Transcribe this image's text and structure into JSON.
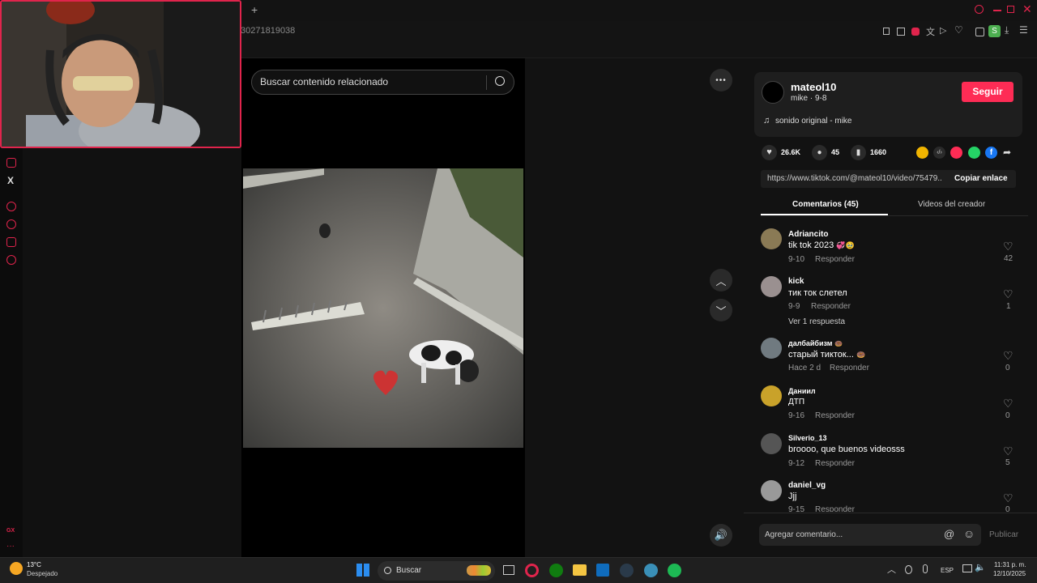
{
  "browser": {
    "url_fragment": "30271819038",
    "new_tab": "+"
  },
  "video_page": {
    "search_placeholder": "Buscar contenido relacionado",
    "more_label": "•••"
  },
  "creator": {
    "username": "mateol10",
    "subtitle": "mike · 9-8",
    "follow_label": "Seguir",
    "sound": "sonido original - mike",
    "music_icon": "♫"
  },
  "stats": {
    "likes": "26.6K",
    "comments": "45",
    "saves": "1660"
  },
  "link": {
    "url": "https://www.tiktok.com/@mateol10/video/75479...",
    "copy_label": "Copiar enlace"
  },
  "tabs": {
    "comments": "Comentarios (45)",
    "creator_videos": "Videos del creador"
  },
  "comments": [
    {
      "user": "Adriancito",
      "text": "tik tok 2023",
      "emoji": "💞🥹",
      "date": "9-10",
      "reply": "Responder",
      "likes": "42",
      "avatar_color": "#8a7a55"
    },
    {
      "user": "kick",
      "text": "тик ток слетел",
      "date": "9-9",
      "reply": "Responder",
      "likes": "1",
      "avatar_color": "#9a9090",
      "more": "Ver 1 respuesta"
    },
    {
      "user": "далбайбизм",
      "user_emoji": "🍩",
      "text": "старый тикток...",
      "emoji": "🍩",
      "date": "Hace 2 d",
      "reply": "Responder",
      "likes": "0",
      "avatar_color": "#707a80"
    },
    {
      "user": "Даниил",
      "text": "ДТП",
      "date": "9-16",
      "reply": "Responder",
      "likes": "0",
      "avatar_color": "#c9a22a"
    },
    {
      "user": "Silverio_13",
      "text": "broooo, que buenos videosss",
      "date": "9-12",
      "reply": "Responder",
      "likes": "5",
      "avatar_color": "#555"
    },
    {
      "user": "daniel_vg",
      "text": "Jjj",
      "date": "9-15",
      "reply": "Responder",
      "likes": "0",
      "avatar_color": "#999"
    }
  ],
  "composer": {
    "placeholder": "Agregar comentario...",
    "post_label": "Publicar",
    "mention": "@",
    "emoji": "☺"
  },
  "sidebar_text": {
    "x_label": "X",
    "gx": "GX",
    "dots": "···"
  },
  "taskbar": {
    "weather_temp": "13°C",
    "weather_desc": "Despejado",
    "search": "Buscar",
    "lang": "ESP",
    "time": "11:31 p. m.",
    "date": "12/10/2025"
  },
  "colors": {
    "accent": "#fe2c55",
    "opera_red": "#e0244c"
  }
}
